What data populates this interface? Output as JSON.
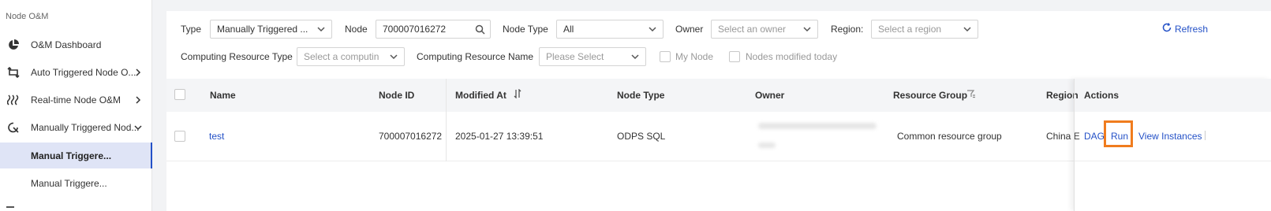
{
  "sidebar": {
    "section_title": "Node O&M",
    "items": [
      {
        "label": "O&M Dashboard",
        "icon": "pie-chart-icon"
      },
      {
        "label": "Auto Triggered Node O...",
        "icon": "cycle-icon"
      },
      {
        "label": "Real-time Node O&M",
        "icon": "stream-icon"
      },
      {
        "label": "Manually Triggered Nod...",
        "icon": "manual-trigger-icon"
      }
    ],
    "sub_items": [
      {
        "label": "Manual Triggere...",
        "active": true
      },
      {
        "label": "Manual Triggere...",
        "active": false
      }
    ]
  },
  "filters": {
    "type_label": "Type",
    "type_value": "Manually Triggered ...",
    "node_label": "Node",
    "node_value": "700007016272",
    "node_type_label": "Node Type",
    "node_type_value": "All",
    "owner_label": "Owner",
    "owner_placeholder": "Select an owner",
    "region_label": "Region:",
    "region_placeholder": "Select a region",
    "refresh_label": "Refresh",
    "crt_label": "Computing Resource Type",
    "crt_placeholder": "Select a computin",
    "crn_label": "Computing Resource Name",
    "crn_placeholder": "Please Select",
    "my_node_label": "My Node",
    "modified_today_label": "Nodes modified today"
  },
  "table": {
    "headers": {
      "name": "Name",
      "node_id": "Node ID",
      "modified_at": "Modified At",
      "node_type": "Node Type",
      "owner": "Owner",
      "resource_group": "Resource Group",
      "region": "Region",
      "actions": "Actions"
    },
    "rows": [
      {
        "name": "test",
        "node_id": "700007016272",
        "modified_at": "2025-01-27 13:39:51",
        "node_type": "ODPS SQL",
        "resource_group": "Common resource group",
        "region": "China E",
        "actions": {
          "dag": "DAG",
          "run": "Run",
          "view_instances": "View Instances"
        }
      }
    ]
  },
  "colors": {
    "accent": "#2451c7",
    "highlight": "#f07c1e",
    "active_bg": "#dfe4f6"
  }
}
